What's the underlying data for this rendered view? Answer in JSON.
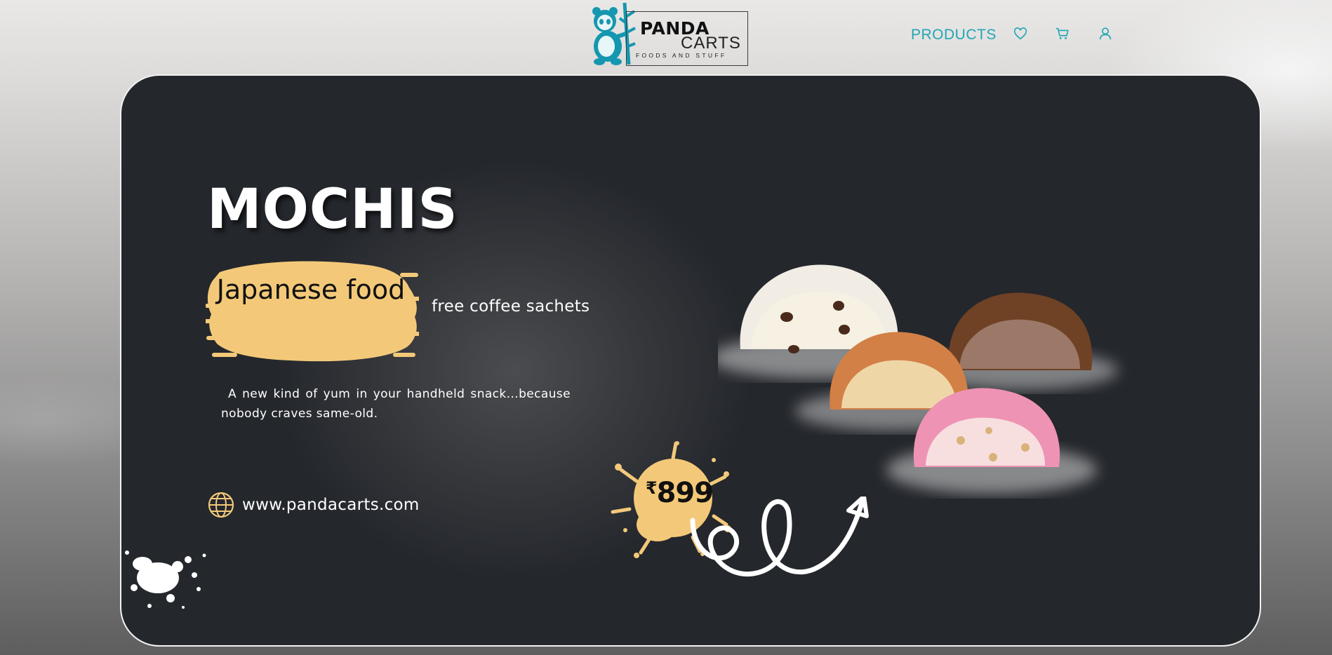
{
  "header": {
    "logo": {
      "line1": "PANDA",
      "line2": "CARTS",
      "line3": "FOODS AND STUFF"
    },
    "nav": {
      "products_label": "PRODUCTS",
      "icons": [
        "heart-icon",
        "cart-icon",
        "user-icon"
      ]
    }
  },
  "hero": {
    "title": "MOCHIS",
    "brush_label": "Japanese food",
    "tagline": "free coffee sachets",
    "description": "A new kind of yum in your handheld snack...because nobody craves same-old.",
    "website": "www.pandacarts.com",
    "price": {
      "currency": "₹",
      "amount": "899"
    }
  },
  "colors": {
    "accent_teal": "#23a6b3",
    "accent_yellow": "#f3c979",
    "card_bg": "#24272c",
    "text_light": "#ffffff"
  }
}
